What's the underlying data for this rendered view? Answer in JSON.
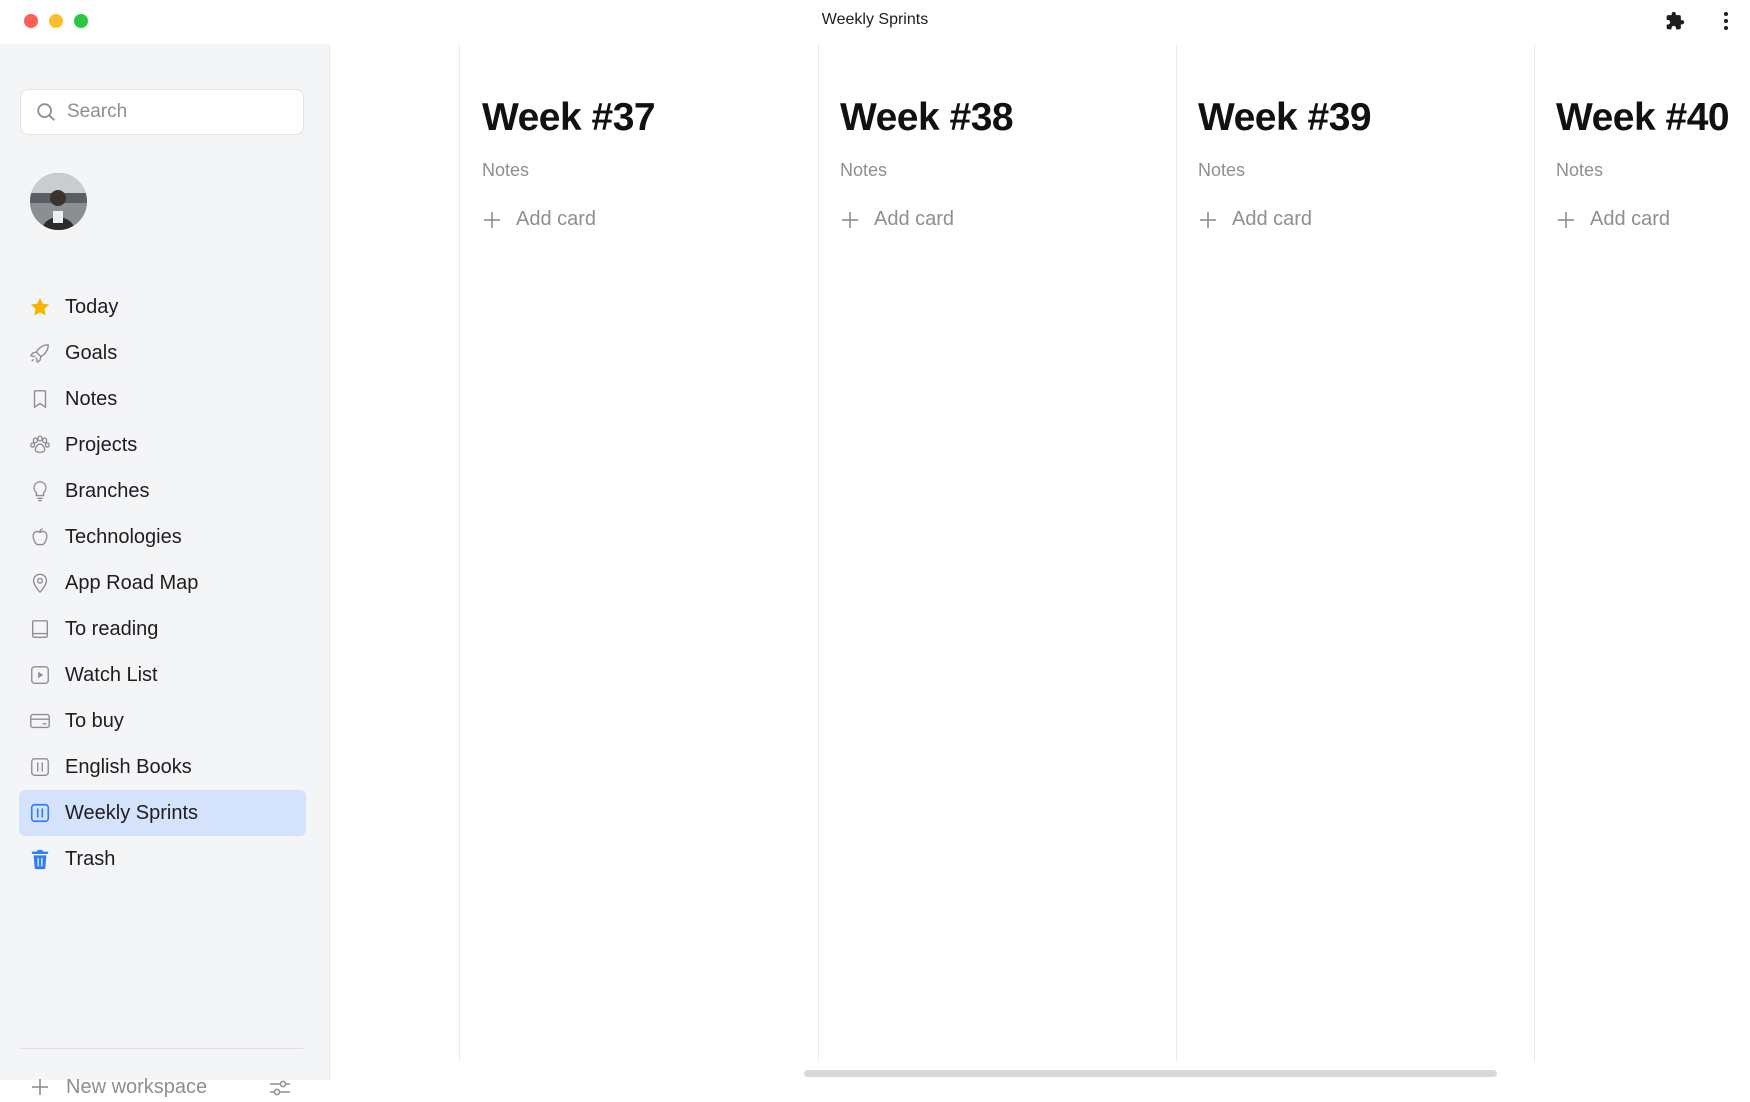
{
  "window": {
    "title": "Weekly Sprints"
  },
  "toolbar": {
    "extensions_icon": "puzzle-icon",
    "more_icon": "kebab-menu-icon"
  },
  "sidebar": {
    "search_placeholder": "Search",
    "items": [
      {
        "label": "Today",
        "icon": "star-icon",
        "active": false
      },
      {
        "label": "Goals",
        "icon": "rocket-icon",
        "active": false
      },
      {
        "label": "Notes",
        "icon": "bookmark-icon",
        "active": false
      },
      {
        "label": "Projects",
        "icon": "paw-icon",
        "active": false
      },
      {
        "label": "Branches",
        "icon": "lightbulb-icon",
        "active": false
      },
      {
        "label": "Technologies",
        "icon": "apple-icon",
        "active": false
      },
      {
        "label": "App Road Map",
        "icon": "location-pin-icon",
        "active": false
      },
      {
        "label": "To reading",
        "icon": "book-icon",
        "active": false
      },
      {
        "label": "Watch List",
        "icon": "play-icon",
        "active": false
      },
      {
        "label": "To buy",
        "icon": "credit-card-icon",
        "active": false
      },
      {
        "label": "English Books",
        "icon": "board-icon",
        "active": false
      },
      {
        "label": "Weekly Sprints",
        "icon": "board-icon",
        "active": true
      },
      {
        "label": "Trash",
        "icon": "trash-icon",
        "active": false
      }
    ],
    "new_workspace_label": "New workspace"
  },
  "board": {
    "columns": [
      {
        "title": "Week #37",
        "notes": "Notes",
        "add_label": "Add card"
      },
      {
        "title": "Week #38",
        "notes": "Notes",
        "add_label": "Add card"
      },
      {
        "title": "Week #39",
        "notes": "Notes",
        "add_label": "Add card"
      },
      {
        "title": "Week #40",
        "notes": "Notes",
        "add_label": "Add card"
      }
    ]
  },
  "colors": {
    "accent": "#2f7cf6",
    "active_bg": "#d4e3fb",
    "star": "#f7b500"
  }
}
